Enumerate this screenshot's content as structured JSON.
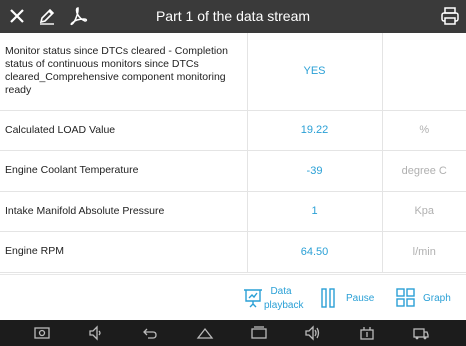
{
  "header": {
    "title": "Part 1 of the data stream"
  },
  "rows": [
    {
      "name": "Monitor status since DTCs cleared - Completion status of continuous monitors since DTCs cleared_Comprehensive component monitoring ready",
      "value": "YES",
      "unit": ""
    },
    {
      "name": "Calculated LOAD Value",
      "value": "19.22",
      "unit": "%"
    },
    {
      "name": "Engine Coolant Temperature",
      "value": "-39",
      "unit": "degree C"
    },
    {
      "name": "Intake Manifold Absolute Pressure",
      "value": "1",
      "unit": "Kpa"
    },
    {
      "name": "Engine RPM",
      "value": "64.50",
      "unit": "l/min"
    }
  ],
  "footer": {
    "playback_line1": "Data",
    "playback_line2": "playback",
    "pause": "Pause",
    "graph": "Graph"
  },
  "colors": {
    "accent": "#2aa0d6",
    "topbar": "#3a3a3a",
    "navbar": "#1c1c1c"
  }
}
